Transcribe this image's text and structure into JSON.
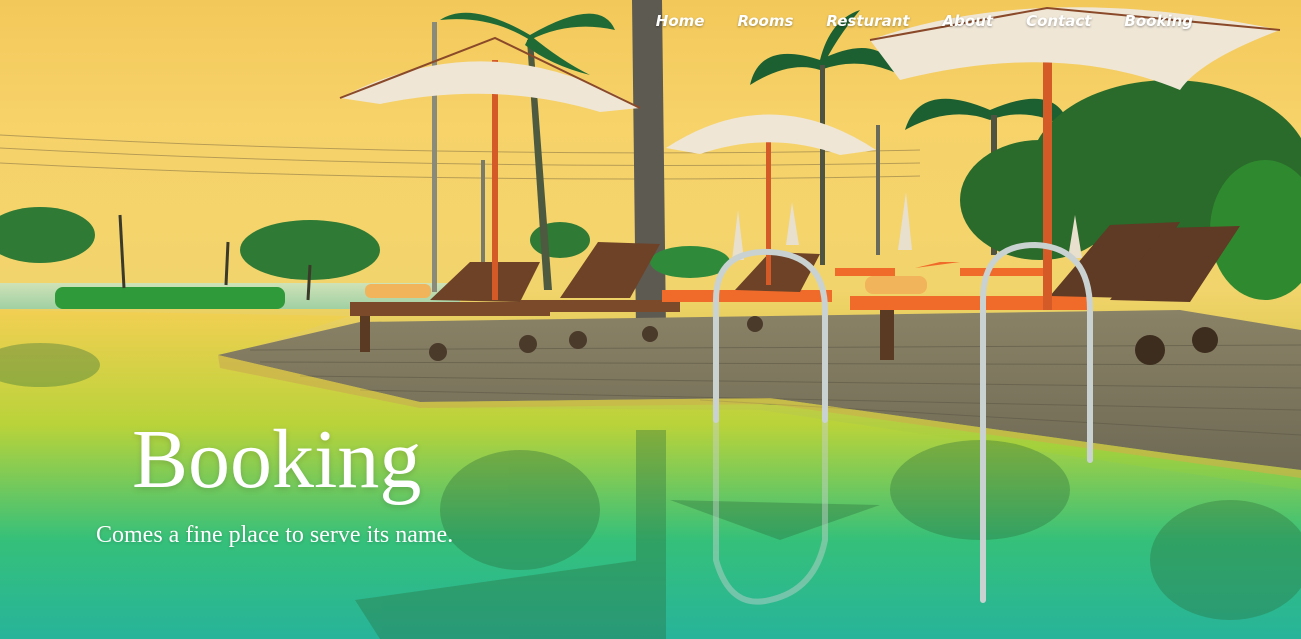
{
  "nav": {
    "items": [
      {
        "label": "Home"
      },
      {
        "label": "Rooms"
      },
      {
        "label": "Resturant"
      },
      {
        "label": "About"
      },
      {
        "label": "Contact"
      },
      {
        "label": "Booking"
      }
    ]
  },
  "hero": {
    "title": "Booking",
    "subtitle": "Comes a fine place to serve its name."
  },
  "colors": {
    "sky_top": "#f3c85a",
    "water": "#2bb592",
    "deck": "#7c7660",
    "umbrella": "#efe6d6",
    "lounger_cushion": "#f06a2a"
  },
  "icons": [
    "palm-tree-icon",
    "umbrella-icon",
    "lounger-icon",
    "pool-ladder-icon"
  ]
}
